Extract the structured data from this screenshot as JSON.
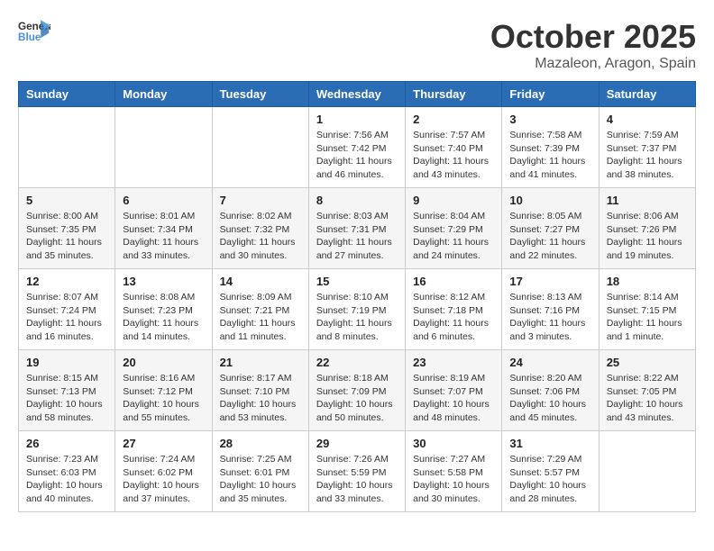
{
  "header": {
    "logo_general": "General",
    "logo_blue": "Blue",
    "month": "October 2025",
    "location": "Mazaleon, Aragon, Spain"
  },
  "days_of_week": [
    "Sunday",
    "Monday",
    "Tuesday",
    "Wednesday",
    "Thursday",
    "Friday",
    "Saturday"
  ],
  "weeks": [
    [
      {
        "day": "",
        "info": ""
      },
      {
        "day": "",
        "info": ""
      },
      {
        "day": "",
        "info": ""
      },
      {
        "day": "1",
        "info": "Sunrise: 7:56 AM\nSunset: 7:42 PM\nDaylight: 11 hours\nand 46 minutes."
      },
      {
        "day": "2",
        "info": "Sunrise: 7:57 AM\nSunset: 7:40 PM\nDaylight: 11 hours\nand 43 minutes."
      },
      {
        "day": "3",
        "info": "Sunrise: 7:58 AM\nSunset: 7:39 PM\nDaylight: 11 hours\nand 41 minutes."
      },
      {
        "day": "4",
        "info": "Sunrise: 7:59 AM\nSunset: 7:37 PM\nDaylight: 11 hours\nand 38 minutes."
      }
    ],
    [
      {
        "day": "5",
        "info": "Sunrise: 8:00 AM\nSunset: 7:35 PM\nDaylight: 11 hours\nand 35 minutes."
      },
      {
        "day": "6",
        "info": "Sunrise: 8:01 AM\nSunset: 7:34 PM\nDaylight: 11 hours\nand 33 minutes."
      },
      {
        "day": "7",
        "info": "Sunrise: 8:02 AM\nSunset: 7:32 PM\nDaylight: 11 hours\nand 30 minutes."
      },
      {
        "day": "8",
        "info": "Sunrise: 8:03 AM\nSunset: 7:31 PM\nDaylight: 11 hours\nand 27 minutes."
      },
      {
        "day": "9",
        "info": "Sunrise: 8:04 AM\nSunset: 7:29 PM\nDaylight: 11 hours\nand 24 minutes."
      },
      {
        "day": "10",
        "info": "Sunrise: 8:05 AM\nSunset: 7:27 PM\nDaylight: 11 hours\nand 22 minutes."
      },
      {
        "day": "11",
        "info": "Sunrise: 8:06 AM\nSunset: 7:26 PM\nDaylight: 11 hours\nand 19 minutes."
      }
    ],
    [
      {
        "day": "12",
        "info": "Sunrise: 8:07 AM\nSunset: 7:24 PM\nDaylight: 11 hours\nand 16 minutes."
      },
      {
        "day": "13",
        "info": "Sunrise: 8:08 AM\nSunset: 7:23 PM\nDaylight: 11 hours\nand 14 minutes."
      },
      {
        "day": "14",
        "info": "Sunrise: 8:09 AM\nSunset: 7:21 PM\nDaylight: 11 hours\nand 11 minutes."
      },
      {
        "day": "15",
        "info": "Sunrise: 8:10 AM\nSunset: 7:19 PM\nDaylight: 11 hours\nand 8 minutes."
      },
      {
        "day": "16",
        "info": "Sunrise: 8:12 AM\nSunset: 7:18 PM\nDaylight: 11 hours\nand 6 minutes."
      },
      {
        "day": "17",
        "info": "Sunrise: 8:13 AM\nSunset: 7:16 PM\nDaylight: 11 hours\nand 3 minutes."
      },
      {
        "day": "18",
        "info": "Sunrise: 8:14 AM\nSunset: 7:15 PM\nDaylight: 11 hours\nand 1 minute."
      }
    ],
    [
      {
        "day": "19",
        "info": "Sunrise: 8:15 AM\nSunset: 7:13 PM\nDaylight: 10 hours\nand 58 minutes."
      },
      {
        "day": "20",
        "info": "Sunrise: 8:16 AM\nSunset: 7:12 PM\nDaylight: 10 hours\nand 55 minutes."
      },
      {
        "day": "21",
        "info": "Sunrise: 8:17 AM\nSunset: 7:10 PM\nDaylight: 10 hours\nand 53 minutes."
      },
      {
        "day": "22",
        "info": "Sunrise: 8:18 AM\nSunset: 7:09 PM\nDaylight: 10 hours\nand 50 minutes."
      },
      {
        "day": "23",
        "info": "Sunrise: 8:19 AM\nSunset: 7:07 PM\nDaylight: 10 hours\nand 48 minutes."
      },
      {
        "day": "24",
        "info": "Sunrise: 8:20 AM\nSunset: 7:06 PM\nDaylight: 10 hours\nand 45 minutes."
      },
      {
        "day": "25",
        "info": "Sunrise: 8:22 AM\nSunset: 7:05 PM\nDaylight: 10 hours\nand 43 minutes."
      }
    ],
    [
      {
        "day": "26",
        "info": "Sunrise: 7:23 AM\nSunset: 6:03 PM\nDaylight: 10 hours\nand 40 minutes."
      },
      {
        "day": "27",
        "info": "Sunrise: 7:24 AM\nSunset: 6:02 PM\nDaylight: 10 hours\nand 37 minutes."
      },
      {
        "day": "28",
        "info": "Sunrise: 7:25 AM\nSunset: 6:01 PM\nDaylight: 10 hours\nand 35 minutes."
      },
      {
        "day": "29",
        "info": "Sunrise: 7:26 AM\nSunset: 5:59 PM\nDaylight: 10 hours\nand 33 minutes."
      },
      {
        "day": "30",
        "info": "Sunrise: 7:27 AM\nSunset: 5:58 PM\nDaylight: 10 hours\nand 30 minutes."
      },
      {
        "day": "31",
        "info": "Sunrise: 7:29 AM\nSunset: 5:57 PM\nDaylight: 10 hours\nand 28 minutes."
      },
      {
        "day": "",
        "info": ""
      }
    ]
  ]
}
